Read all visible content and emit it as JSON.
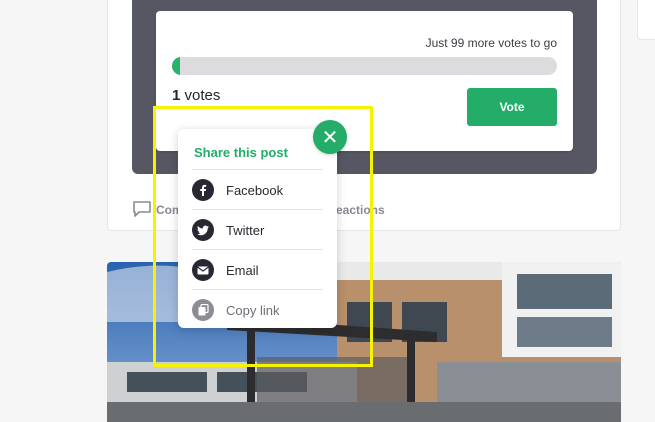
{
  "poll": {
    "votes_to_go": "Just 99 more votes to go",
    "progress_fraction": 0.01,
    "votes_number": "1",
    "votes_label": " votes",
    "vote_button": "Vote"
  },
  "post_actions": {
    "comment_label": "Com",
    "reactions_label": "eactions"
  },
  "share_menu": {
    "title": "Share this post",
    "items": [
      {
        "label": "Facebook",
        "icon": "facebook-icon"
      },
      {
        "label": "Twitter",
        "icon": "twitter-icon"
      },
      {
        "label": "Email",
        "icon": "email-icon"
      },
      {
        "label": "Copy link",
        "icon": "copy-link-icon"
      }
    ],
    "close_icon": "close-icon"
  },
  "colors": {
    "accent": "#23ad68",
    "panel": "#575763",
    "highlight": "#f7f200"
  }
}
